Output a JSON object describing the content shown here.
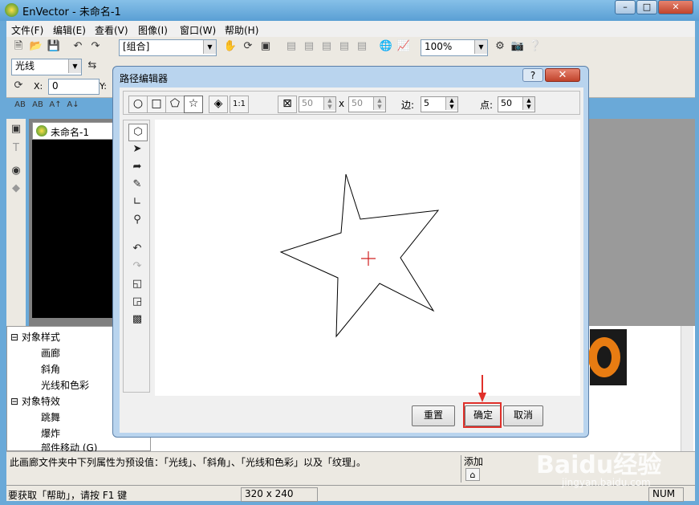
{
  "app": {
    "title": "EnVector - 未命名-1"
  },
  "window_buttons": [
    "–",
    "□",
    "✕"
  ],
  "menu": [
    "文件(F)",
    "编辑(E)",
    "查看(V)",
    "图像(I)",
    "窗口(W)",
    "帮助(H)"
  ],
  "toolbar": {
    "group_combo": "[组合]",
    "zoom_combo": "100%",
    "light_combo": "光线",
    "x_label": "X:",
    "x_value": "0",
    "y_label": "Y:"
  },
  "doc_tab": "未命名-1",
  "tree": {
    "group1": "对象样式",
    "items1": [
      "画廊",
      "斜角",
      "光线和色彩"
    ],
    "group2": "对象特效",
    "items2": [
      "跳舞",
      "爆炸",
      "部件移动 (G)"
    ]
  },
  "description": "此画廊文件夹中下列属性为预设值：「光线」、「斜角」、「光线和色彩」以及「纹理」。",
  "add_label": "添加",
  "status": {
    "help": "要获取「帮助」，请按 F1 键",
    "size": "320 x 240",
    "num": "NUM"
  },
  "dialog": {
    "title": "路径编辑器",
    "help": "?",
    "close": "✕",
    "width_value": "50",
    "times": "x",
    "height_value": "50",
    "sides_label": "边:",
    "sides_value": "5",
    "points_label": "点:",
    "points_value": "50",
    "reset": "重置",
    "ok": "确定",
    "cancel": "取消"
  },
  "watermark": {
    "text": "Baidu经验",
    "url": "jingyan.baidu.com"
  },
  "colors": {
    "highlight": "#e0302a",
    "crosshair": "#d02020"
  }
}
